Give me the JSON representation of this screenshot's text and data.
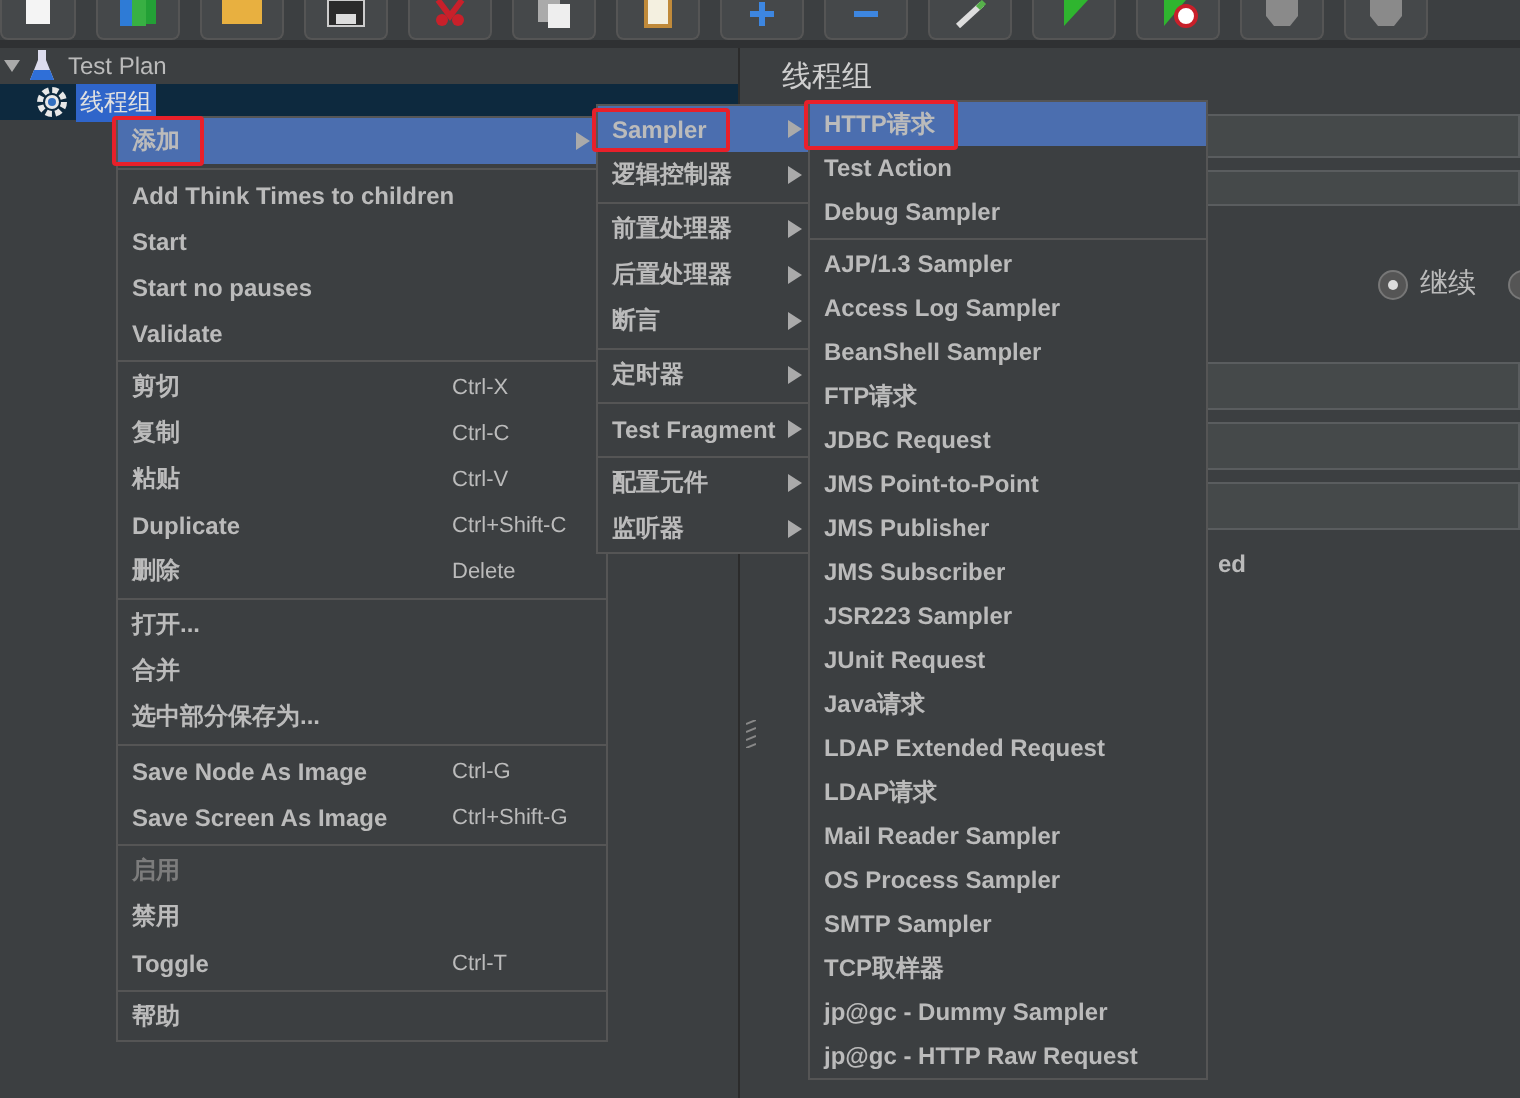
{
  "toolbar": {
    "buttons": [
      {
        "kind": "new"
      },
      {
        "kind": "templates"
      },
      {
        "kind": "open"
      },
      {
        "kind": "save"
      },
      {
        "kind": "cut"
      },
      {
        "kind": "copy"
      },
      {
        "kind": "paste"
      },
      {
        "kind": "expand"
      },
      {
        "kind": "collapse"
      },
      {
        "kind": "toggle"
      },
      {
        "kind": "start"
      },
      {
        "kind": "start-no-timers"
      },
      {
        "kind": "stop"
      },
      {
        "kind": "shutdown"
      }
    ]
  },
  "tree": {
    "items": [
      {
        "label": "Test Plan",
        "kind": "plan",
        "expanded": true,
        "selected": false,
        "children": [
          {
            "label": "线程组",
            "kind": "thread-group",
            "selected": true
          }
        ]
      }
    ]
  },
  "panel": {
    "title": "线程组",
    "radios": [
      {
        "label": "继续",
        "selected": true
      },
      {
        "selected": false
      }
    ],
    "fragment": "ed"
  },
  "context_menu": {
    "groups": [
      [
        {
          "label": "添加",
          "submenu": true,
          "selected": true,
          "disabled": false,
          "marked": true
        }
      ],
      [
        {
          "label": "Add Think Times to children",
          "submenu": false,
          "selected": false,
          "disabled": false,
          "marked": false
        },
        {
          "label": "Start",
          "submenu": false,
          "selected": false,
          "disabled": false,
          "marked": false
        },
        {
          "label": "Start no pauses",
          "submenu": false,
          "selected": false,
          "disabled": false,
          "marked": false
        },
        {
          "label": "Validate",
          "submenu": false,
          "selected": false,
          "disabled": false,
          "marked": false
        }
      ],
      [
        {
          "label": "剪切",
          "shortcut": "Ctrl-X",
          "submenu": false,
          "selected": false,
          "disabled": false,
          "marked": false
        },
        {
          "label": "复制",
          "shortcut": "Ctrl-C",
          "submenu": false,
          "selected": false,
          "disabled": false,
          "marked": false
        },
        {
          "label": "粘贴",
          "shortcut": "Ctrl-V",
          "submenu": false,
          "selected": false,
          "disabled": false,
          "marked": false
        },
        {
          "label": "Duplicate",
          "shortcut": "Ctrl+Shift-C",
          "submenu": false,
          "selected": false,
          "disabled": false,
          "marked": false
        },
        {
          "label": "删除",
          "shortcut": "Delete",
          "submenu": false,
          "selected": false,
          "disabled": false,
          "marked": false
        }
      ],
      [
        {
          "label": "打开...",
          "submenu": false,
          "selected": false,
          "disabled": false,
          "marked": false
        },
        {
          "label": "合并",
          "submenu": false,
          "selected": false,
          "disabled": false,
          "marked": false
        },
        {
          "label": "选中部分保存为...",
          "submenu": false,
          "selected": false,
          "disabled": false,
          "marked": false
        }
      ],
      [
        {
          "label": "Save Node As Image",
          "shortcut": "Ctrl-G",
          "submenu": false,
          "selected": false,
          "disabled": false,
          "marked": false
        },
        {
          "label": "Save Screen As Image",
          "shortcut": "Ctrl+Shift-G",
          "submenu": false,
          "selected": false,
          "disabled": false,
          "marked": false
        }
      ],
      [
        {
          "label": "启用",
          "submenu": false,
          "selected": false,
          "disabled": true,
          "marked": false
        },
        {
          "label": "禁用",
          "submenu": false,
          "selected": false,
          "disabled": false,
          "marked": false
        },
        {
          "label": "Toggle",
          "shortcut": "Ctrl-T",
          "submenu": false,
          "selected": false,
          "disabled": false,
          "marked": false
        }
      ],
      [
        {
          "label": "帮助",
          "submenu": false,
          "selected": false,
          "disabled": false,
          "marked": false
        }
      ]
    ]
  },
  "add_submenu": {
    "groups": [
      [
        {
          "label": "Sampler",
          "submenu": true,
          "selected": true,
          "marked": true
        },
        {
          "label": "逻辑控制器",
          "submenu": true,
          "selected": false,
          "marked": false
        }
      ],
      [
        {
          "label": "前置处理器",
          "submenu": true,
          "selected": false,
          "marked": false
        },
        {
          "label": "后置处理器",
          "submenu": true,
          "selected": false,
          "marked": false
        },
        {
          "label": "断言",
          "submenu": true,
          "selected": false,
          "marked": false
        }
      ],
      [
        {
          "label": "定时器",
          "submenu": true,
          "selected": false,
          "marked": false
        }
      ],
      [
        {
          "label": "Test Fragment",
          "submenu": true,
          "selected": false,
          "marked": false
        }
      ],
      [
        {
          "label": "配置元件",
          "submenu": true,
          "selected": false,
          "marked": false
        },
        {
          "label": "监听器",
          "submenu": true,
          "selected": false,
          "marked": false
        }
      ]
    ]
  },
  "sampler_submenu": {
    "groups": [
      [
        {
          "label": "HTTP请求",
          "submenu": false,
          "selected": true,
          "marked": true
        },
        {
          "label": "Test Action",
          "submenu": false,
          "selected": false,
          "marked": false
        },
        {
          "label": "Debug Sampler",
          "submenu": false,
          "selected": false,
          "marked": false
        }
      ],
      [
        {
          "label": "AJP/1.3 Sampler",
          "submenu": false,
          "selected": false,
          "marked": false
        },
        {
          "label": "Access Log Sampler",
          "submenu": false,
          "selected": false,
          "marked": false
        },
        {
          "label": "BeanShell Sampler",
          "submenu": false,
          "selected": false,
          "marked": false
        },
        {
          "label": "FTP请求",
          "submenu": false,
          "selected": false,
          "marked": false
        },
        {
          "label": "JDBC Request",
          "submenu": false,
          "selected": false,
          "marked": false
        },
        {
          "label": "JMS Point-to-Point",
          "submenu": false,
          "selected": false,
          "marked": false
        },
        {
          "label": "JMS Publisher",
          "submenu": false,
          "selected": false,
          "marked": false
        },
        {
          "label": "JMS Subscriber",
          "submenu": false,
          "selected": false,
          "marked": false
        },
        {
          "label": "JSR223 Sampler",
          "submenu": false,
          "selected": false,
          "marked": false
        },
        {
          "label": "JUnit Request",
          "submenu": false,
          "selected": false,
          "marked": false
        },
        {
          "label": "Java请求",
          "submenu": false,
          "selected": false,
          "marked": false
        },
        {
          "label": "LDAP Extended Request",
          "submenu": false,
          "selected": false,
          "marked": false
        },
        {
          "label": "LDAP请求",
          "submenu": false,
          "selected": false,
          "marked": false
        },
        {
          "label": "Mail Reader Sampler",
          "submenu": false,
          "selected": false,
          "marked": false
        },
        {
          "label": "OS Process Sampler",
          "submenu": false,
          "selected": false,
          "marked": false
        },
        {
          "label": "SMTP Sampler",
          "submenu": false,
          "selected": false,
          "marked": false
        },
        {
          "label": "TCP取样器",
          "submenu": false,
          "selected": false,
          "marked": false
        },
        {
          "label": "jp@gc - Dummy Sampler",
          "submenu": false,
          "selected": false,
          "marked": false
        },
        {
          "label": "jp@gc - HTTP Raw Request",
          "submenu": false,
          "selected": false,
          "marked": false
        }
      ]
    ]
  }
}
